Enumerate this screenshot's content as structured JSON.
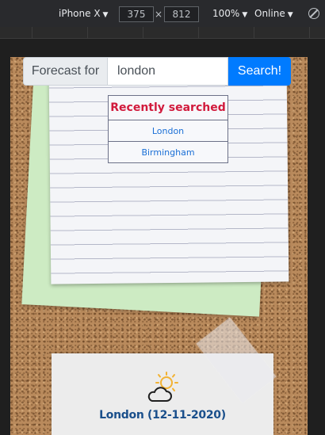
{
  "devtools": {
    "device": "iPhone X",
    "width": "375",
    "height": "812",
    "dimension_separator": "×",
    "zoom": "100%",
    "network": "Online",
    "caret": "▼"
  },
  "search": {
    "prefix_label": "Forecast for",
    "input_value": "london",
    "button_label": "Search!"
  },
  "recent": {
    "heading": "Recently searched",
    "items": [
      "London",
      "Birmingham"
    ]
  },
  "weather": {
    "icon": "partly-cloudy-icon",
    "title": "London (12-11-2020)"
  },
  "colors": {
    "accent": "#007bff",
    "heading_red": "#d11a3c",
    "link_blue": "#1a6fd6",
    "title_blue": "#1a4f8b"
  }
}
